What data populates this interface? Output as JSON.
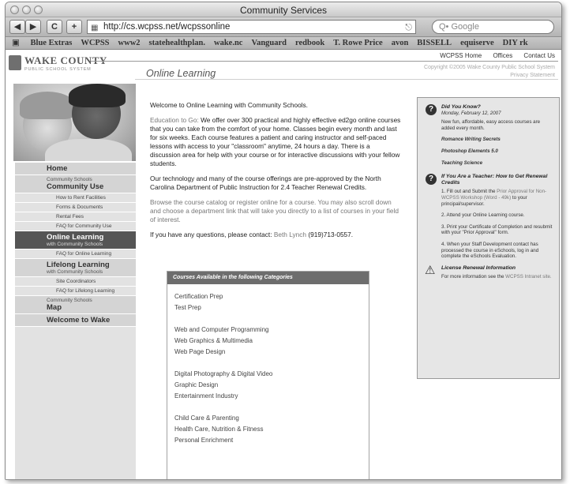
{
  "window": {
    "title": "Community Services"
  },
  "toolbar": {
    "back": "◀",
    "forward": "▶",
    "reload": "C",
    "add": "+",
    "url": "http://cs.wcpss.net/wcpssonline",
    "search_placeholder": "Q• Google"
  },
  "bookmarks": [
    "Blue Extras",
    "WCPSS",
    "www2",
    "statehealthplan.",
    "wake.nc",
    "Vanguard",
    "redbook",
    "T. Rowe Price",
    "avon",
    "BISSELL",
    "equiserve",
    "DIY rk"
  ],
  "site": {
    "logo_name": "WAKE COUNTY",
    "logo_sub": "PUBLIC SCHOOL SYSTEM",
    "top_nav": [
      "WCPSS Home",
      "Offices",
      "Contact Us"
    ],
    "page_title": "Online Learning",
    "copyright": "Copyright ©2005 Wake County Public School System",
    "privacy": "Privacy Statement"
  },
  "sidebar": {
    "home": "Home",
    "community_small": "Community Schools",
    "community_use": "Community Use",
    "sub1": [
      "How to Rent Facilities",
      "Forms & Documents",
      "Rental Fees",
      "FAQ for Community Use"
    ],
    "online_learning": "Online Learning",
    "online_small": "with Community Schools",
    "sub2": [
      "FAQ for Online Learning"
    ],
    "lifelong": "Lifelong Learning",
    "lifelong_small": "with Community Schools",
    "sub3": [
      "Site Coordinators",
      "FAQ for Lifelong Learning"
    ],
    "map_small": "Community Schools",
    "map": "Map",
    "welcome": "Welcome to Wake"
  },
  "content": {
    "welcome": "Welcome to Online Learning with Community Schools.",
    "edu_link": "Education to Go:",
    "edu_text": " We offer over 300 practical and highly effective ed2go online courses that you can take from the comfort of your home. Classes begin every month and last for six weeks. Each course features a patient and caring instructor and self-paced lessons with access to your \"classroom\" anytime, 24 hours a day. There is a discussion area for help with your course or for interactive discussions with your fellow students.",
    "tech": "Our technology and many of the course offerings are pre-approved by the North Carolina Department of Public Instruction for 2.4 Teacher Renewal Credits.",
    "browse": "Browse the course catalog or register online for a course. You may also scroll down and choose a department link that will take you directly to a list of courses in your field of interest.",
    "questions_prefix": "If you have any questions, please contact: ",
    "contact_name": "Beth Lynch",
    "contact_phone": " (919)713-0557."
  },
  "categories": {
    "title": "Courses Available in the following Categories",
    "groups": [
      [
        "Certification Prep",
        "Test Prep"
      ],
      [
        "Web and Computer Programming",
        "Web Graphics & Multimedia",
        "Web Page Design"
      ],
      [
        "Digital Photography & Digital Video",
        "Graphic Design",
        "Entertainment Industry"
      ],
      [
        "Child Care & Parenting",
        "Health Care, Nutrition & Fitness",
        "Personal Enrichment"
      ]
    ]
  },
  "right": {
    "did_you_know": "Did You Know?",
    "date": "Monday, February 12, 2007",
    "new_courses": "New fun, affordable, easy access courses are added every month.",
    "course1": "Romance Writing Secrets",
    "course2": "Photoshop Elements 5.0",
    "course3": "Teaching Science",
    "teacher_title": "If You Are a Teacher: How to Get Renewal Credits",
    "step1a": "1. Fill out and Submit the ",
    "step1_link": "Prior Approval for Non-WCPSS Workshop (Word - 49k)",
    "step1b": " to your principal/supervisor.",
    "step2": "2. Attend your Online Learning course.",
    "step3": "3. Print your Certificate of Completion and resubmit with your \"Prior Approval\" form.",
    "step4": "4. When your Staff Development contact has processed the course in eSchools, log in and complete the eSchools Evaluation.",
    "license_title": "License Renewal Information",
    "license_a": "For more information see the ",
    "license_link": "WCPSS Intranet site."
  }
}
